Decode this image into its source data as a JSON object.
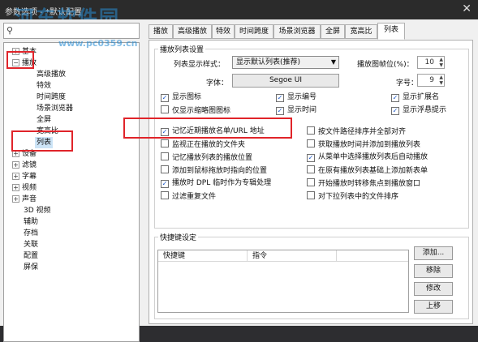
{
  "window": {
    "title": "参数选项 - *默认配置",
    "close_glyph": "✕",
    "watermark": "河东软件园",
    "watermark_url": "www.pc0359.cn"
  },
  "tree": {
    "items": [
      {
        "label": "基本",
        "expander": "+"
      },
      {
        "label": "播放",
        "expander": "−"
      },
      {
        "label": "高级播放"
      },
      {
        "label": "特效"
      },
      {
        "label": "时间跨度"
      },
      {
        "label": "场景浏览器"
      },
      {
        "label": "全屏"
      },
      {
        "label": "宽高比"
      },
      {
        "label": "列表"
      },
      {
        "label": "设备",
        "expander": "+"
      },
      {
        "label": "滤镜",
        "expander": "+"
      },
      {
        "label": "字幕",
        "expander": "+"
      },
      {
        "label": "视频",
        "expander": "+"
      },
      {
        "label": "声音",
        "expander": "+"
      },
      {
        "label": "3D 视频"
      },
      {
        "label": "辅助"
      },
      {
        "label": "存档"
      },
      {
        "label": "关联"
      },
      {
        "label": "配置"
      },
      {
        "label": "屏保"
      }
    ]
  },
  "tabs": [
    "播放",
    "高级播放",
    "特效",
    "时间跨度",
    "场景浏览器",
    "全屏",
    "宽高比",
    "列表"
  ],
  "playlist": {
    "group_title": "播放列表设置",
    "style_label": "列表显示样式：",
    "style_value": "显示默认列表(推荐)",
    "thumb_label": "播放图帧位(%)：",
    "thumb_value": "10",
    "font_label": "字体：",
    "font_value": "Segoe UI",
    "size_label": "字号：",
    "size_value": "9",
    "checkboxes_top": [
      {
        "label": "显示图标",
        "checked": true
      },
      {
        "label": "显示编号",
        "checked": true
      },
      {
        "label": "显示扩展名",
        "checked": true
      },
      {
        "label": "仅显示缩略图图标",
        "checked": false
      },
      {
        "label": "显示时间",
        "checked": true
      },
      {
        "label": "显示浮悬提示",
        "checked": true
      }
    ],
    "checkboxes_left": [
      {
        "label": "记忆近期播放名单/URL 地址",
        "checked": true
      },
      {
        "label": "监视正在播放的文件夹",
        "checked": false
      },
      {
        "label": "记忆播放列表的播放位置",
        "checked": false
      },
      {
        "label": "添加到鼠标拖放时指向的位置",
        "checked": false
      },
      {
        "label": "播放时 DPL 临时作为专辑处理",
        "checked": true
      },
      {
        "label": "过滤重复文件",
        "checked": false
      }
    ],
    "checkboxes_right": [
      {
        "label": "按文件路径排序并全部对齐",
        "checked": false
      },
      {
        "label": "获取播放时间并添加到播放列表",
        "checked": false
      },
      {
        "label": "从菜单中选择播放列表后自动播放",
        "checked": true
      },
      {
        "label": "在原有播放列表基础上添加新表单",
        "checked": false
      },
      {
        "label": "开始播放时转移焦点到播放窗口",
        "checked": false
      },
      {
        "label": "对下拉列表中的文件排序",
        "checked": false
      }
    ]
  },
  "shortcuts": {
    "group_title": "快捷键设定",
    "col_key": "快捷键",
    "col_cmd": "指令",
    "buttons": [
      "添加...",
      "移除",
      "修改",
      "上移"
    ]
  },
  "colors": {
    "highlight_box": "#e0242a",
    "selection": "#cce4f7"
  }
}
